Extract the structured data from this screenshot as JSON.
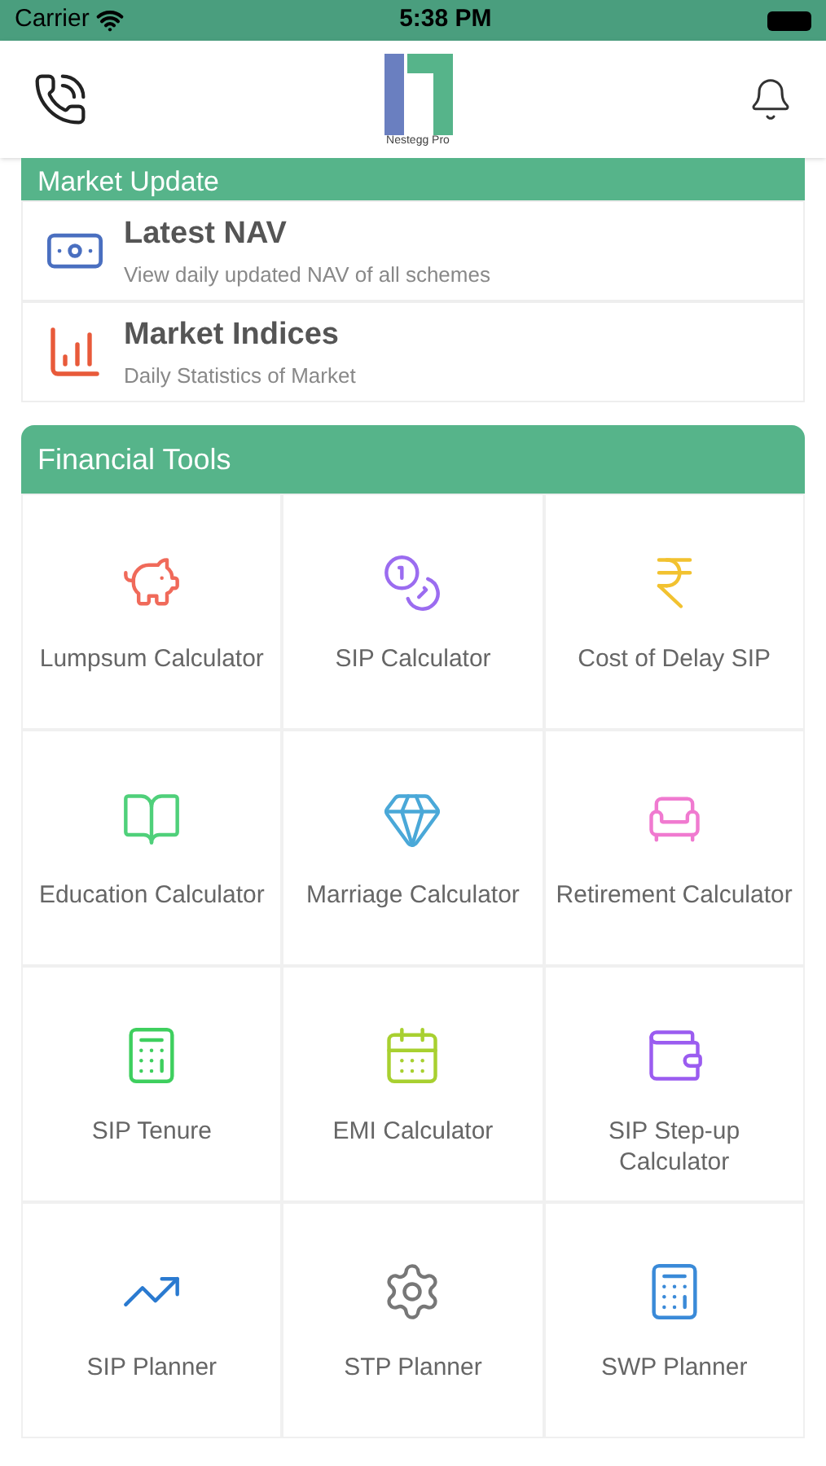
{
  "status_bar": {
    "carrier": "Carrier",
    "time": "5:38 PM"
  },
  "header": {
    "logo_text": "Nestegg Pro"
  },
  "market_update": {
    "title": "Market Update",
    "items": [
      {
        "title": "Latest NAV",
        "subtitle": "View daily updated NAV of all schemes"
      },
      {
        "title": "Market Indices",
        "subtitle": "Daily Statistics of Market"
      }
    ]
  },
  "financial_tools": {
    "title": "Financial Tools",
    "tools": [
      {
        "label": "Lumpsum Calculator"
      },
      {
        "label": "SIP Calculator"
      },
      {
        "label": "Cost of Delay SIP"
      },
      {
        "label": "Education Calculator"
      },
      {
        "label": "Marriage Calculator"
      },
      {
        "label": "Retirement Calculator"
      },
      {
        "label": "SIP Tenure"
      },
      {
        "label": "EMI Calculator"
      },
      {
        "label": "SIP Step-up Calculator"
      },
      {
        "label": "SIP Planner"
      },
      {
        "label": "STP Planner"
      },
      {
        "label": "SWP Planner"
      }
    ]
  }
}
